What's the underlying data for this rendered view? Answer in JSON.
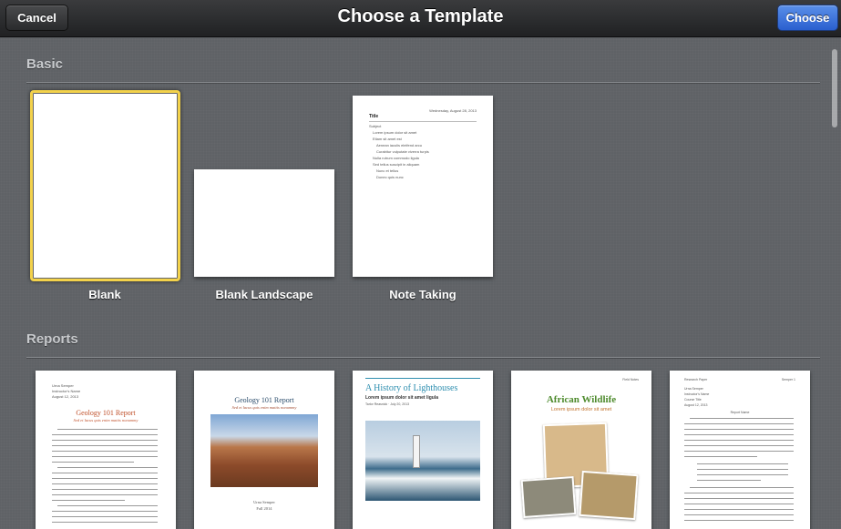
{
  "toolbar": {
    "title": "Choose a Template",
    "cancel_label": "Cancel",
    "choose_label": "Choose"
  },
  "sections": {
    "basic": {
      "title": "Basic",
      "templates": [
        {
          "label": "Blank",
          "selected": true
        },
        {
          "label": "Blank Landscape"
        },
        {
          "label": "Note Taking"
        }
      ]
    },
    "reports": {
      "title": "Reports"
    }
  },
  "note_taking": {
    "date": "Wednesday, August 28, 2013",
    "title": "Title",
    "subject": "Subject",
    "items": [
      "Lorem ipsum dolor sit amet",
      "Etiam sit amet est",
      "Aenean iaculis eleifend arcu",
      "Curabitur vulputate viverra turpis",
      "Nulla rutrum commodo ligula",
      "Sed tellus suscipit in aliquam",
      "Nunc et tellus",
      "Donec quis nunc"
    ]
  },
  "reports": {
    "geology1": {
      "author": "Urna Semper",
      "instructor": "Instructor's Name",
      "date": "August 12, 2013",
      "title": "Geology 101 Report",
      "subtitle": "Sed et lacus quis enim mattis nonummy"
    },
    "geology2": {
      "title": "Geology 101 Report",
      "subtitle": "Sed et lacus quis enim mattis nonummy",
      "author": "Urna Semper",
      "term": "Fall 2014"
    },
    "lighthouses": {
      "title": "A History of Lighthouses",
      "subtitle": "Lorem ipsum dolor sit amet ligula",
      "byline": "Tarlor Reasnick · July 20, 2013"
    },
    "wildlife": {
      "header": "Field Notes",
      "title": "African Wildlife",
      "subtitle": "Lorem ipsum dolor sit amet"
    },
    "research": {
      "header_left": "Research Paper",
      "header_right": "Semper 1",
      "name": "Urna Semper",
      "instructor": "Instructor's Name",
      "course": "Course Title",
      "date": "August 12, 2013",
      "title": "Report Name"
    }
  },
  "colors": {
    "accent_blue": "#2a5fcf",
    "selected_border": "#f3d24b",
    "geology_title": "#c0502a",
    "lighthouse_title": "#2f8fb0",
    "wildlife_title": "#4d8a2c"
  }
}
